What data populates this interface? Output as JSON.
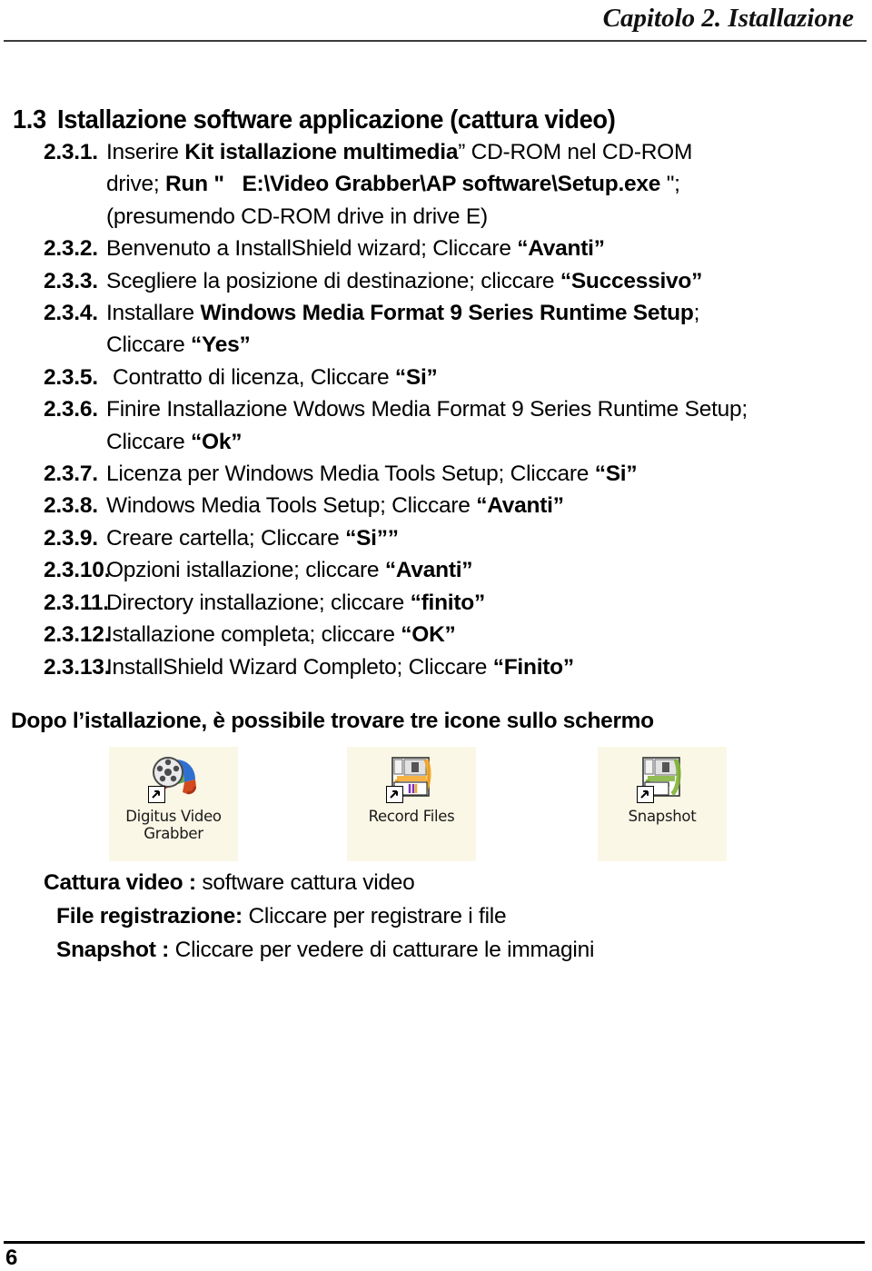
{
  "header": {
    "running_title": "Capitolo 2. Istallazione"
  },
  "section": {
    "number": "1.3",
    "title": "Istallazione software applicazione (cattura video)"
  },
  "steps": [
    {
      "number": "2.3.1.",
      "lines": [
        [
          {
            "t": "Inserire ",
            "b": false
          },
          {
            "t": "Kit istallazione multimedia",
            "b": true
          },
          {
            "t": "” CD-ROM nel CD-ROM",
            "b": false
          }
        ],
        [
          {
            "t": "drive; ",
            "b": false
          },
          {
            "t": "Run \"",
            "b": true
          },
          {
            "t": "   ",
            "b": false
          },
          {
            "t": "E:\\Video Grabber\\AP software\\Setup.exe",
            "b": true
          },
          {
            "t": " \";",
            "b": false
          }
        ],
        [
          {
            "t": "(presumendo CD-ROM drive in drive E)",
            "b": false
          }
        ]
      ]
    },
    {
      "number": "2.3.2.",
      "lines": [
        [
          {
            "t": "Benvenuto a InstallShield wizard; Cliccare ",
            "b": false
          },
          {
            "t": "“Avanti”",
            "b": true
          }
        ]
      ]
    },
    {
      "number": "2.3.3.",
      "lines": [
        [
          {
            "t": "Scegliere la posizione di destinazione; cliccare ",
            "b": false
          },
          {
            "t": "“Successivo”",
            "b": true
          }
        ]
      ]
    },
    {
      "number": "2.3.4.",
      "lines": [
        [
          {
            "t": "Installare ",
            "b": false
          },
          {
            "t": "Windows Media Format 9 Series Runtime Setup",
            "b": true
          },
          {
            "t": ";",
            "b": false
          }
        ],
        [
          {
            "t": "Cliccare ",
            "b": false
          },
          {
            "t": "“Yes”",
            "b": true
          }
        ]
      ]
    },
    {
      "number": "2.3.5.",
      "indent": true,
      "lines": [
        [
          {
            "t": "Contratto di licenza, Cliccare ",
            "b": false
          },
          {
            "t": "“Si”",
            "b": true
          }
        ]
      ]
    },
    {
      "number": "2.3.6.",
      "lines": [
        [
          {
            "t": "Finire Installazione Wdows Media Format 9 Series Runtime Setup;",
            "b": false
          }
        ],
        [
          {
            "t": "Cliccare ",
            "b": false
          },
          {
            "t": "“Ok”",
            "b": true
          }
        ]
      ]
    },
    {
      "number": "2.3.7.",
      "lines": [
        [
          {
            "t": "Licenza per Windows Media Tools Setup; Cliccare ",
            "b": false
          },
          {
            "t": "“Si”",
            "b": true
          }
        ]
      ]
    },
    {
      "number": "2.3.8.",
      "lines": [
        [
          {
            "t": "Windows Media Tools Setup; Cliccare ",
            "b": false
          },
          {
            "t": "“Avanti”",
            "b": true
          }
        ]
      ]
    },
    {
      "number": "2.3.9.",
      "lines": [
        [
          {
            "t": "Creare cartella; Cliccare ",
            "b": false
          },
          {
            "t": "“Si””",
            "b": true
          }
        ]
      ]
    },
    {
      "number": "2.3.10.",
      "lines": [
        [
          {
            "t": "Opzioni istallazione; cliccare ",
            "b": false
          },
          {
            "t": "“Avanti”",
            "b": true
          }
        ]
      ]
    },
    {
      "number": "2.3.11.",
      "lines": [
        [
          {
            "t": "Directory installazione; cliccare ",
            "b": false
          },
          {
            "t": "“finito”",
            "b": true
          }
        ]
      ]
    },
    {
      "number": "2.3.12.",
      "lines": [
        [
          {
            "t": "Istallazione completa; cliccare ",
            "b": false
          },
          {
            "t": "“OK”",
            "b": true
          }
        ]
      ]
    },
    {
      "number": "2.3.13.",
      "lines": [
        [
          {
            "t": "InstallShield Wizard Completo; Cliccare ",
            "b": false
          },
          {
            "t": "“Finito”",
            "b": true
          }
        ]
      ]
    }
  ],
  "note": "Dopo l’istallazione, è possibile trovare tre icone sullo schermo",
  "desktop_icons": [
    {
      "icon": "film-reel-icon",
      "caption": "Digitus Video Grabber",
      "shortcut": true
    },
    {
      "icon": "folder-record-files-icon",
      "caption": "Record Files",
      "shortcut": true
    },
    {
      "icon": "folder-snapshot-icon",
      "caption": "Snapshot",
      "shortcut": true
    }
  ],
  "legend": [
    {
      "term": "Cattura video :",
      "desc": " software cattura video"
    },
    {
      "term": "File registrazione:",
      "desc": " Cliccare per registrare i file"
    },
    {
      "term": "Snapshot :",
      "desc": " Cliccare per vedere di catturare le immagini"
    }
  ],
  "footer": {
    "page_number": "6"
  },
  "colors": {
    "text": "#000000",
    "rule": "#3b3b3b",
    "icon_tile_bg": "#fbf7e6",
    "reel_dark": "#4a4a4a",
    "folder_yellow": "#f5a623",
    "folder_green": "#7fb234"
  }
}
